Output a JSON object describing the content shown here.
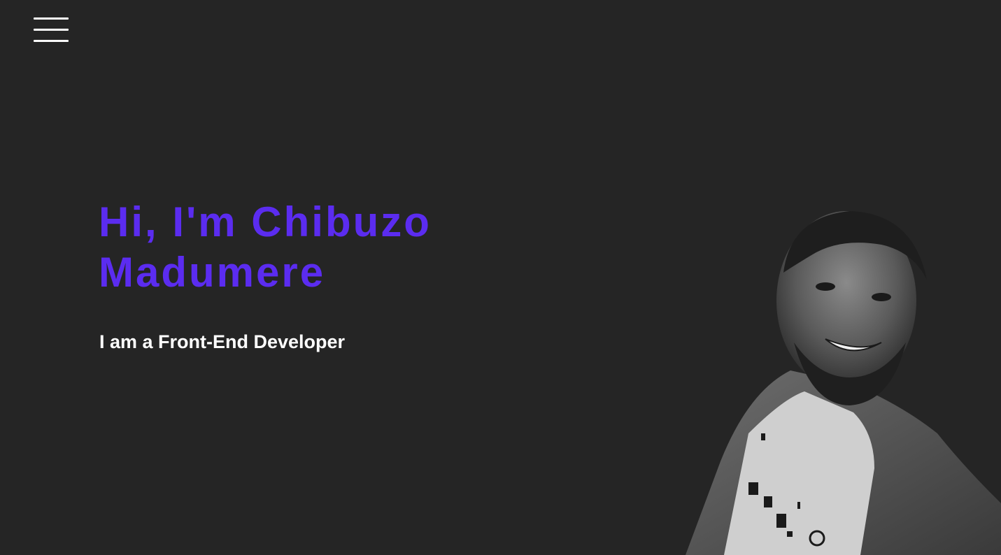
{
  "header": {
    "menu_icon": "hamburger-menu-icon"
  },
  "hero": {
    "title_line1": "Hi, I'm Chibuzo",
    "title_line2": "Madumere",
    "subtitle": "I am a Front-End Developer",
    "photo_icon": "portrait-photo"
  },
  "colors": {
    "background": "#252525",
    "accent": "#5b2cf0",
    "text": "#ffffff"
  }
}
